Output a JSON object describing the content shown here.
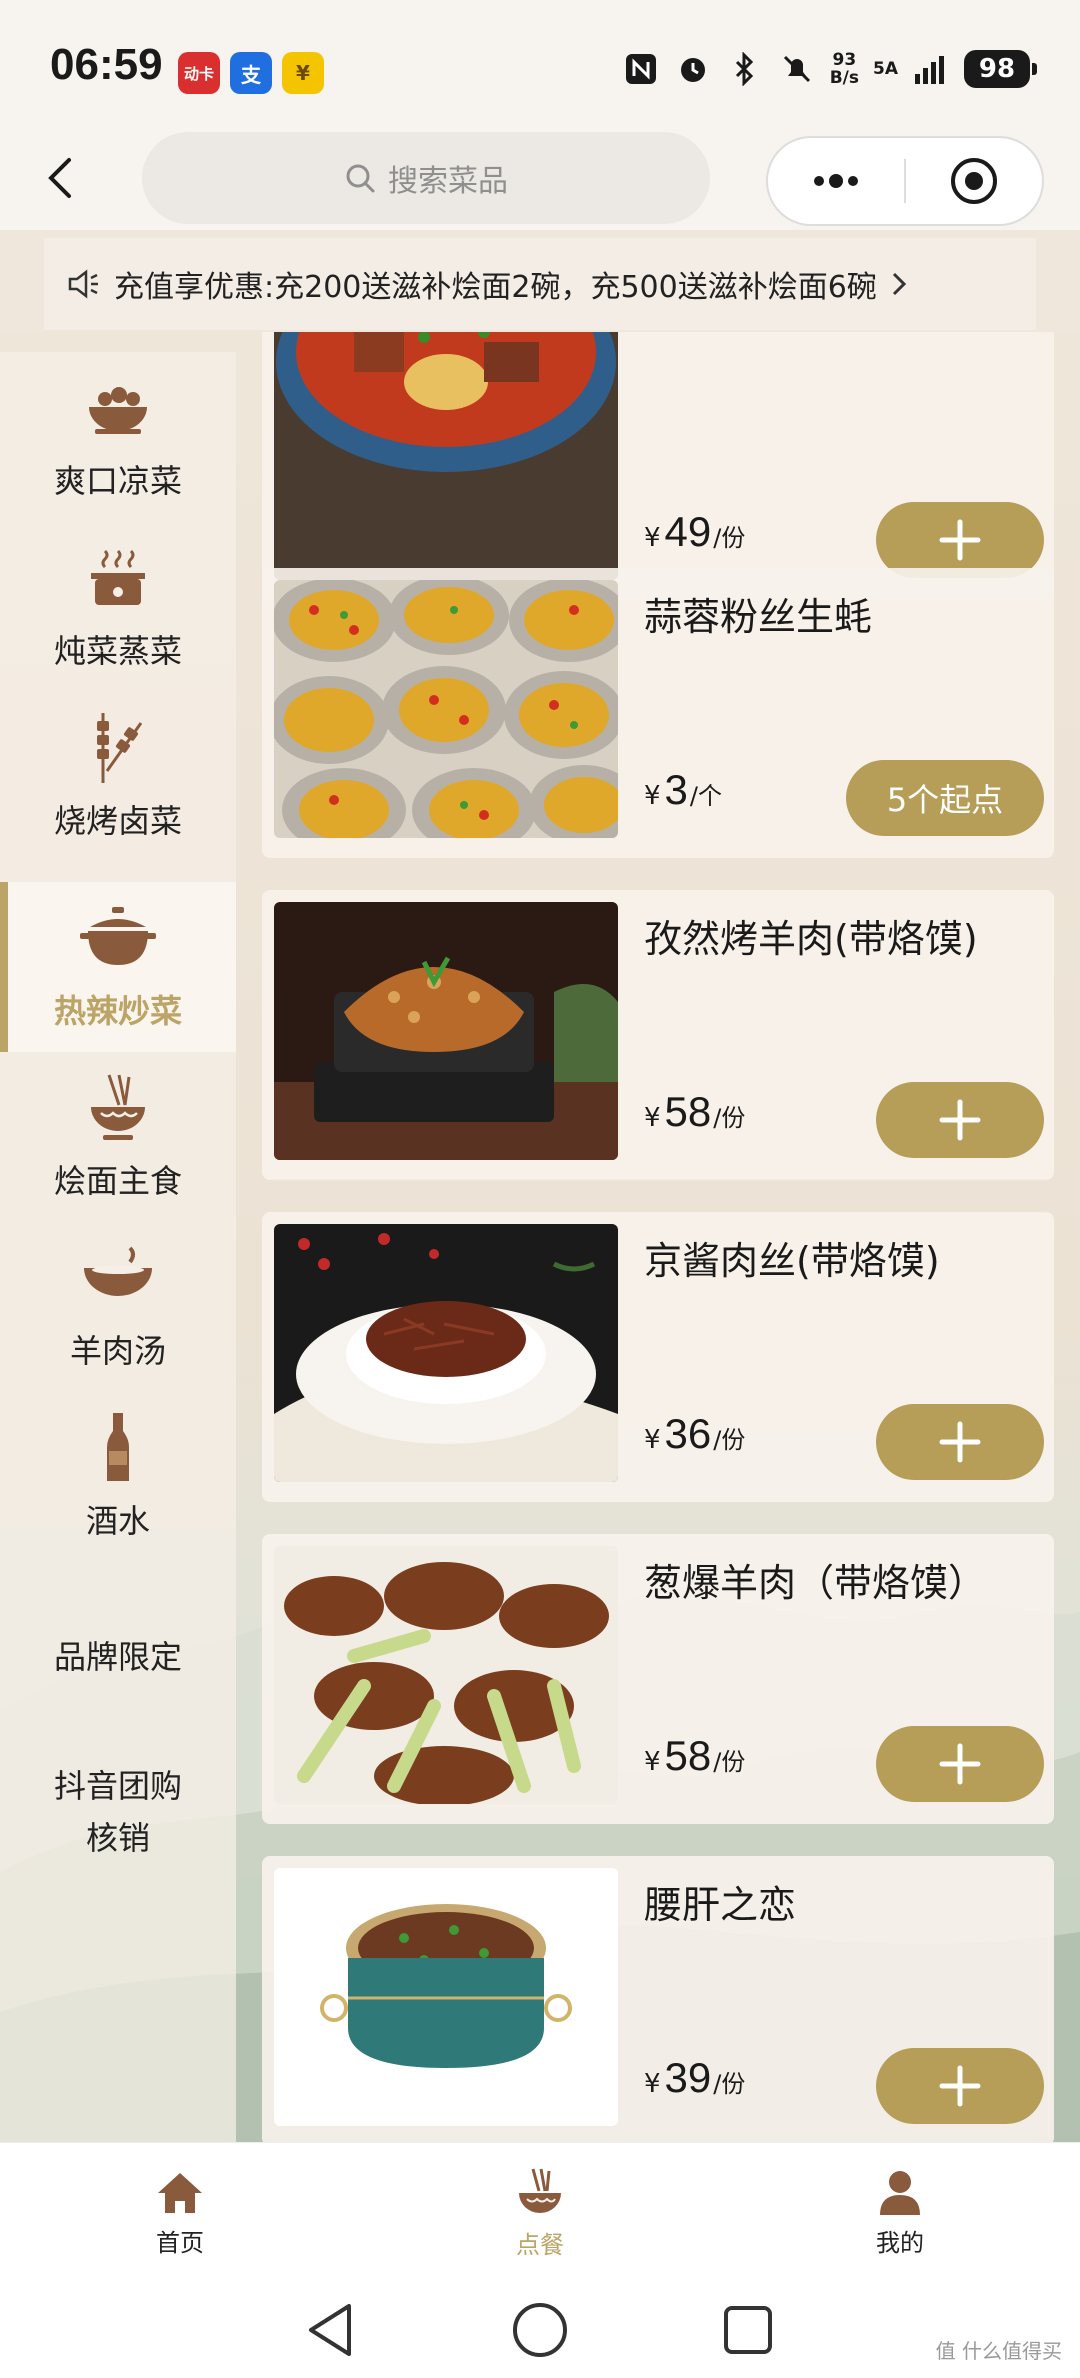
{
  "status_bar": {
    "time": "06:59",
    "badges": [
      "动卡",
      "支",
      "¥"
    ],
    "net_speed_value": "93",
    "net_speed_unit": "B/s",
    "signal": "5A",
    "battery": "98"
  },
  "header": {
    "search_placeholder": "搜索菜品"
  },
  "notice": {
    "text": "充值享优惠:充200送滋补烩面2碗，充500送滋补烩面6碗"
  },
  "sidebar": {
    "items": [
      {
        "label": "爽口凉菜",
        "icon": "cold-dish-icon"
      },
      {
        "label": "炖菜蒸菜",
        "icon": "steamer-icon"
      },
      {
        "label": "烧烤卤菜",
        "icon": "skewer-icon"
      },
      {
        "label": "热辣炒菜",
        "icon": "clay-pot-icon",
        "active": true
      },
      {
        "label": "烩面主食",
        "icon": "noodle-bowl-icon"
      },
      {
        "label": "羊肉汤",
        "icon": "soup-bowl-icon"
      },
      {
        "label": "酒水",
        "icon": "bottle-icon"
      },
      {
        "label": "品牌限定"
      },
      {
        "label": "抖音团购\n核销"
      }
    ]
  },
  "dishes": [
    {
      "name": "",
      "currency": "¥",
      "price": "49",
      "unit": "/份",
      "action": "add"
    },
    {
      "name": "蒜蓉粉丝生蚝",
      "currency": "¥",
      "price": "3",
      "unit": "/个",
      "action": "5个起点"
    },
    {
      "name": "孜然烤羊肉(带烙馍)",
      "currency": "¥",
      "price": "58",
      "unit": "/份",
      "action": "add"
    },
    {
      "name": "京酱肉丝(带烙馍)",
      "currency": "¥",
      "price": "36",
      "unit": "/份",
      "action": "add"
    },
    {
      "name": "葱爆羊肉（带烙馍）",
      "currency": "¥",
      "price": "58",
      "unit": "/份",
      "action": "add"
    },
    {
      "name": "腰肝之恋",
      "currency": "¥",
      "price": "39",
      "unit": "/份",
      "action": "add"
    }
  ],
  "tabbar": {
    "items": [
      {
        "label": "首页",
        "icon": "home-icon"
      },
      {
        "label": "点餐",
        "icon": "order-bowl-icon",
        "active": true
      },
      {
        "label": "我的",
        "icon": "user-icon"
      }
    ]
  },
  "watermark": "值 什么值得买",
  "colors": {
    "accent": "#b69e58",
    "active_text": "#bba466",
    "background": "#efe7dc"
  }
}
